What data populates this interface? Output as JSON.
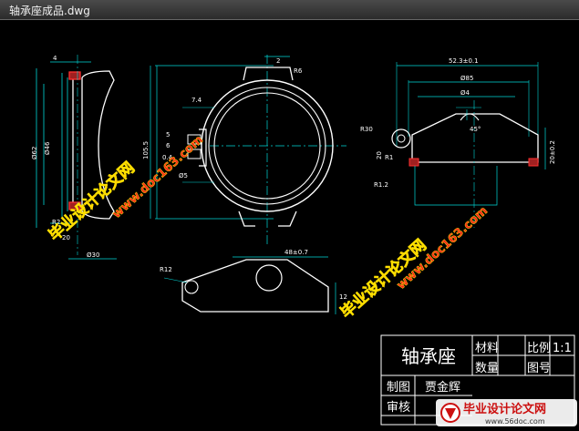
{
  "window": {
    "title": "轴承座成品.dwg"
  },
  "dimensions": {
    "top_gap": "2",
    "top_radius": "R6",
    "left_4": "4",
    "left_diam1": "Ø62",
    "left_diam2": "Ø46",
    "left_r2": "R2",
    "left_20": "20",
    "left_30": "Ø30",
    "center_74": "7.4",
    "center_1055": "105.5",
    "center_5": "5",
    "center_6": "6",
    "center_04": "0.4",
    "center_r5": "Ø5",
    "right_523": "52.3±0.1",
    "right_phi85": "Ø85",
    "right_phi4": "Ø4",
    "right_angle": "45°",
    "right_r30": "R30",
    "right_20": "20",
    "right_r1": "R1",
    "right_r12": "R1.2",
    "right_20_side": "20±0.2",
    "bottom_48": "48±0.7",
    "bottom_r12": "R12",
    "bottom_12": "12"
  },
  "titleblock": {
    "part_name": "轴承座",
    "material_label": "材料",
    "scale_label": "比例",
    "scale_value": "1:1",
    "qty_label": "数量",
    "drawing_no_label": "图号",
    "drawn_label": "制图",
    "drawn_name": "贾金辉",
    "check_label": "审核"
  },
  "watermarks": {
    "cn": "毕业设计论文网",
    "url": "www.doc163.com",
    "footer_cn": "毕业设计论文网",
    "footer_url": "www.56doc.com"
  },
  "colors": {
    "line_white": "#ffffff",
    "dim_cyan": "#00d8d8",
    "red": "#ff3030",
    "watermark_red": "#ff2020",
    "watermark_yellow": "#ffe000"
  }
}
